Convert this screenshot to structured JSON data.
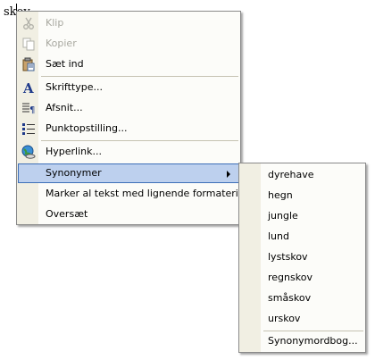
{
  "document": {
    "text": "skov"
  },
  "context_menu": {
    "items": [
      {
        "label": "Klip",
        "icon": "scissors-icon",
        "disabled": true
      },
      {
        "label": "Kopier",
        "icon": "copy-icon",
        "disabled": true
      },
      {
        "label": "Sæt ind",
        "icon": "paste-icon",
        "disabled": false
      },
      {
        "label": "Skrifttype...",
        "icon": "font-icon",
        "disabled": false
      },
      {
        "label": "Afsnit...",
        "icon": "paragraph-icon",
        "disabled": false
      },
      {
        "label": "Punktopstilling...",
        "icon": "bullets-icon",
        "disabled": false
      },
      {
        "label": "Hyperlink...",
        "icon": "hyperlink-icon",
        "disabled": false
      },
      {
        "label": "Synonymer",
        "icon": "",
        "disabled": false,
        "highlighted": true
      },
      {
        "label": "Marker al tekst med lignende formatering",
        "icon": "",
        "disabled": false
      },
      {
        "label": "Oversæt",
        "icon": "",
        "disabled": false
      }
    ]
  },
  "synonyms_submenu": {
    "items": [
      "dyrehave",
      "hegn",
      "jungle",
      "lund",
      "lystskov",
      "regnskov",
      "småskov",
      "urskov"
    ],
    "thesaurus_label": "Synonymordbog..."
  }
}
